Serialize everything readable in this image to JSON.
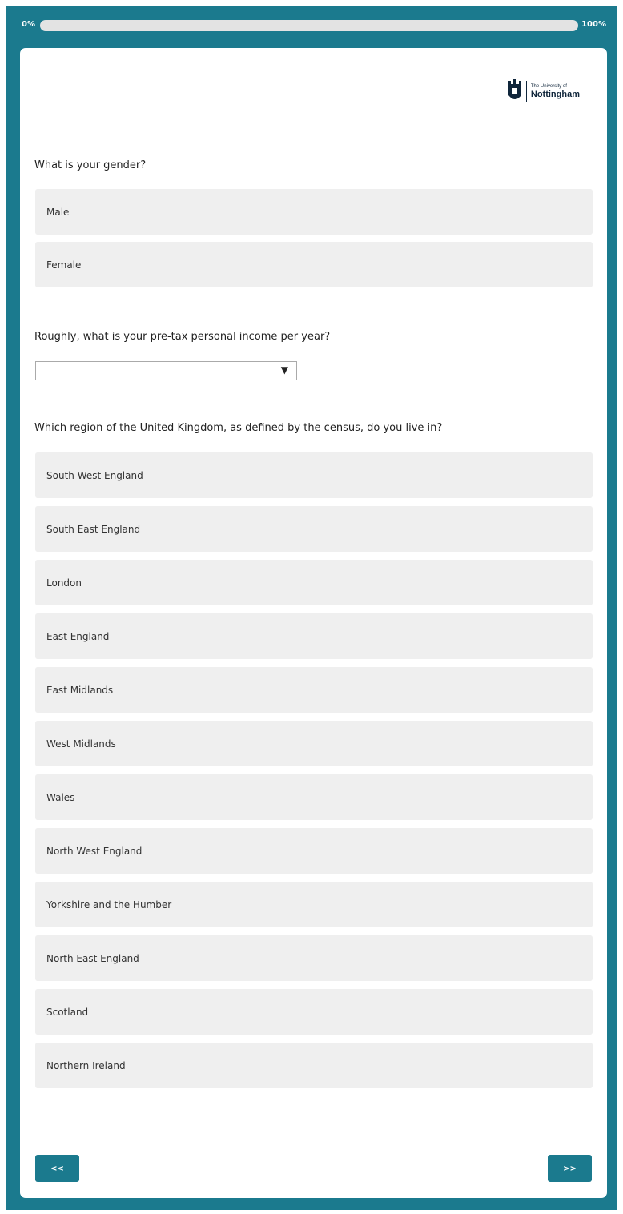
{
  "progress": {
    "start_label": "0%",
    "end_label": "100%",
    "value_percent": 0
  },
  "logo": {
    "line1": "The University of",
    "line2": "Nottingham"
  },
  "questions": {
    "gender": {
      "text": "What is your gender?",
      "options": [
        "Male",
        "Female"
      ]
    },
    "income": {
      "text": "Roughly, what is your pre-tax personal income per year?",
      "selected": "",
      "arrow": "▼"
    },
    "region": {
      "text": "Which region of the United Kingdom, as defined by the census, do you live in?",
      "options": [
        "South West England",
        "South East England",
        "London",
        "East England",
        "East Midlands",
        "West Midlands",
        "Wales",
        "North West England",
        "Yorkshire and the Humber",
        "North East England",
        "Scotland",
        "Northern Ireland"
      ]
    }
  },
  "nav": {
    "prev_label": "<<",
    "next_label": ">>"
  },
  "colors": {
    "brand": "#1b7a8e",
    "choice_bg": "#efefef",
    "logo_navy": "#10263b"
  }
}
